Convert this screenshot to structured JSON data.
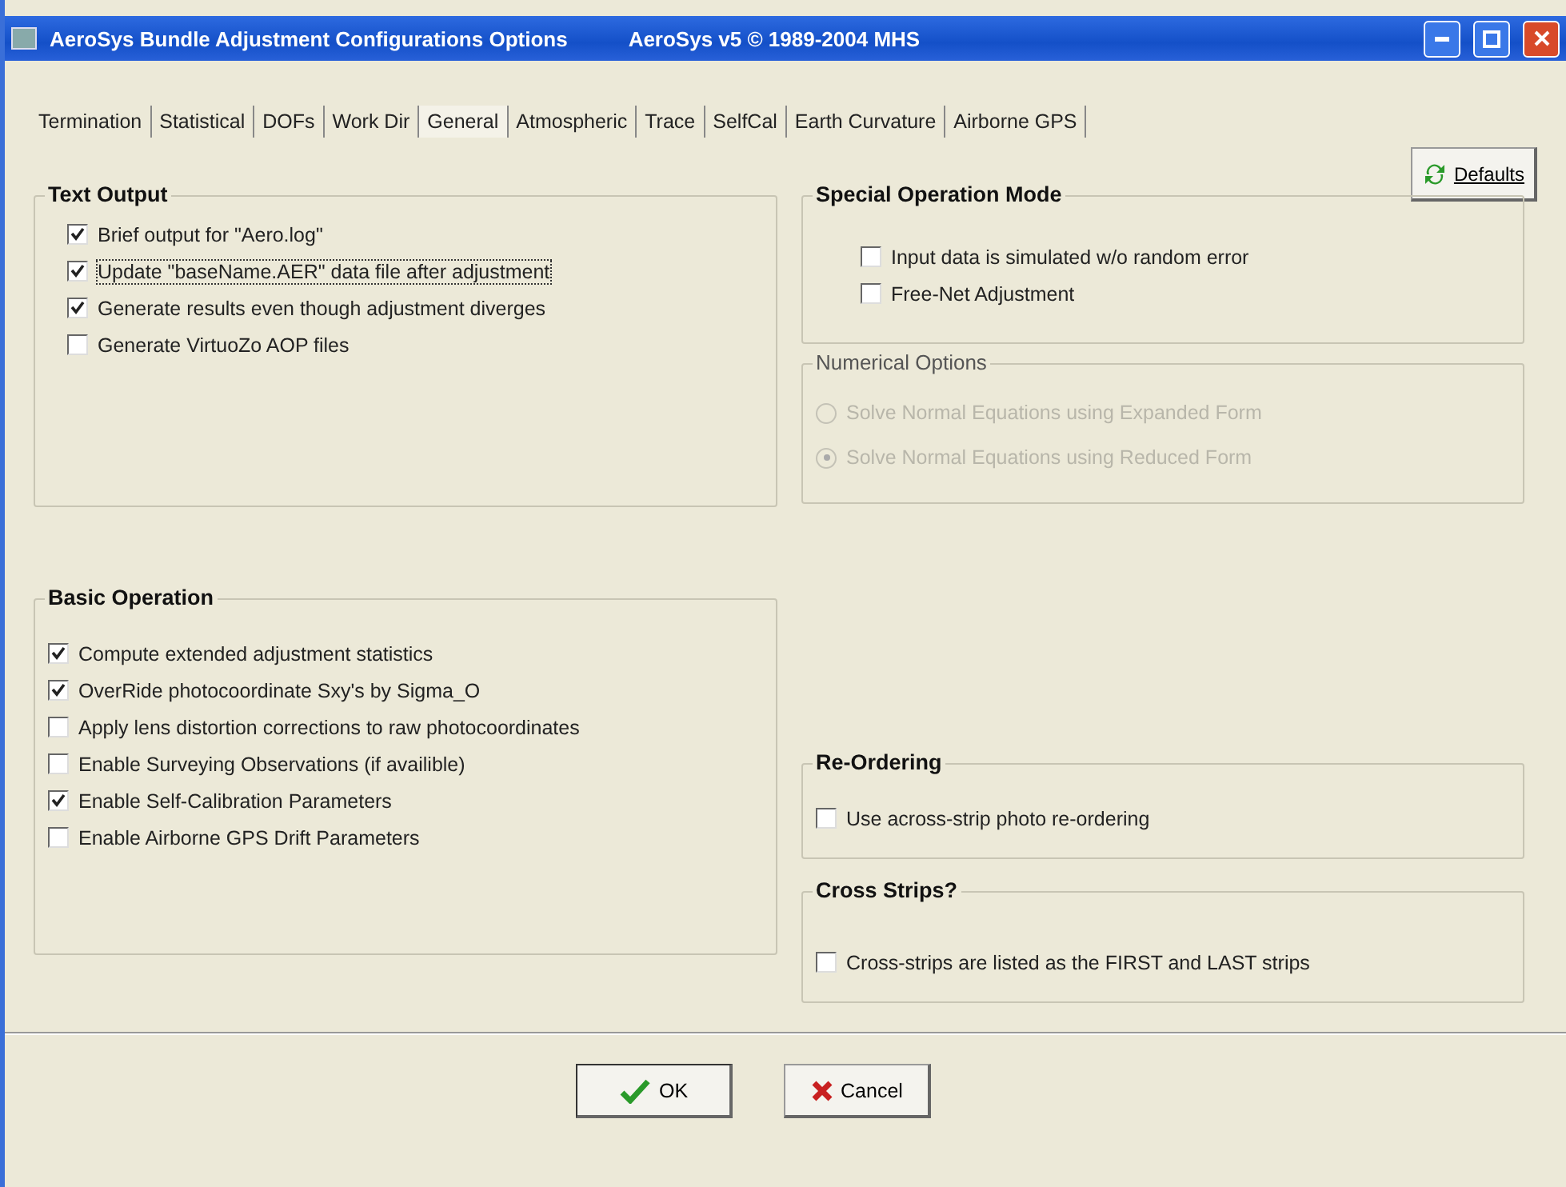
{
  "window": {
    "title": "AeroSys Bundle Adjustment Configurations Options",
    "subtitle": "AeroSys v5 © 1989-2004 MHS"
  },
  "tabs": [
    {
      "label": "Termination",
      "selected": false
    },
    {
      "label": "Statistical",
      "selected": false
    },
    {
      "label": "DOFs",
      "selected": false
    },
    {
      "label": "Work Dir",
      "selected": false
    },
    {
      "label": "General",
      "selected": true
    },
    {
      "label": "Atmospheric",
      "selected": false
    },
    {
      "label": "Trace",
      "selected": false
    },
    {
      "label": "SelfCal",
      "selected": false
    },
    {
      "label": "Earth Curvature",
      "selected": false
    },
    {
      "label": "Airborne GPS",
      "selected": false
    }
  ],
  "defaults_button": {
    "label": "Defaults"
  },
  "text_output": {
    "title": "Text Output",
    "items": [
      {
        "label": "Brief output for  \"Aero.log\"",
        "checked": true,
        "focused": false
      },
      {
        "label": "Update \"baseName.AER\" data file after adjustment",
        "checked": true,
        "focused": true
      },
      {
        "label": "Generate results even though adjustment diverges",
        "checked": true,
        "focused": false
      },
      {
        "label": "Generate VirtuoZo  AOP files",
        "checked": false,
        "focused": false
      }
    ]
  },
  "basic_operation": {
    "title": "Basic Operation",
    "items": [
      {
        "label": "Compute extended  adjustment statistics",
        "checked": true
      },
      {
        "label": "OverRide photocoordinate Sxy's by Sigma_O",
        "checked": true
      },
      {
        "label": "Apply lens distortion corrections to raw photocoordinates",
        "checked": false
      },
      {
        "label": "Enable Surveying Observations  (if availible)",
        "checked": false
      },
      {
        "label": "Enable Self-Calibration Parameters",
        "checked": true
      },
      {
        "label": "Enable Airborne GPS Drift  Parameters",
        "checked": false
      }
    ]
  },
  "special_operation_mode": {
    "title": "Special Operation Mode",
    "items": [
      {
        "label": "Input data is simulated w/o random error",
        "checked": false
      },
      {
        "label": "Free-Net Adjustment",
        "checked": false
      }
    ]
  },
  "numerical_options": {
    "title": "Numerical Options",
    "disabled": true,
    "items": [
      {
        "label": "Solve Normal Equations using Expanded Form",
        "selected": false
      },
      {
        "label": "Solve Normal Equations using Reduced  Form",
        "selected": true
      }
    ]
  },
  "re_ordering": {
    "title": "Re-Ordering",
    "items": [
      {
        "label": "Use across-strip photo re-ordering",
        "checked": false
      }
    ]
  },
  "cross_strips": {
    "title": "Cross Strips?",
    "items": [
      {
        "label": "Cross-strips are listed as the FIRST and LAST strips",
        "checked": false
      }
    ]
  },
  "buttons": [
    {
      "kind": "ok",
      "label": "OK"
    },
    {
      "kind": "cancel",
      "label": "Cancel"
    }
  ]
}
